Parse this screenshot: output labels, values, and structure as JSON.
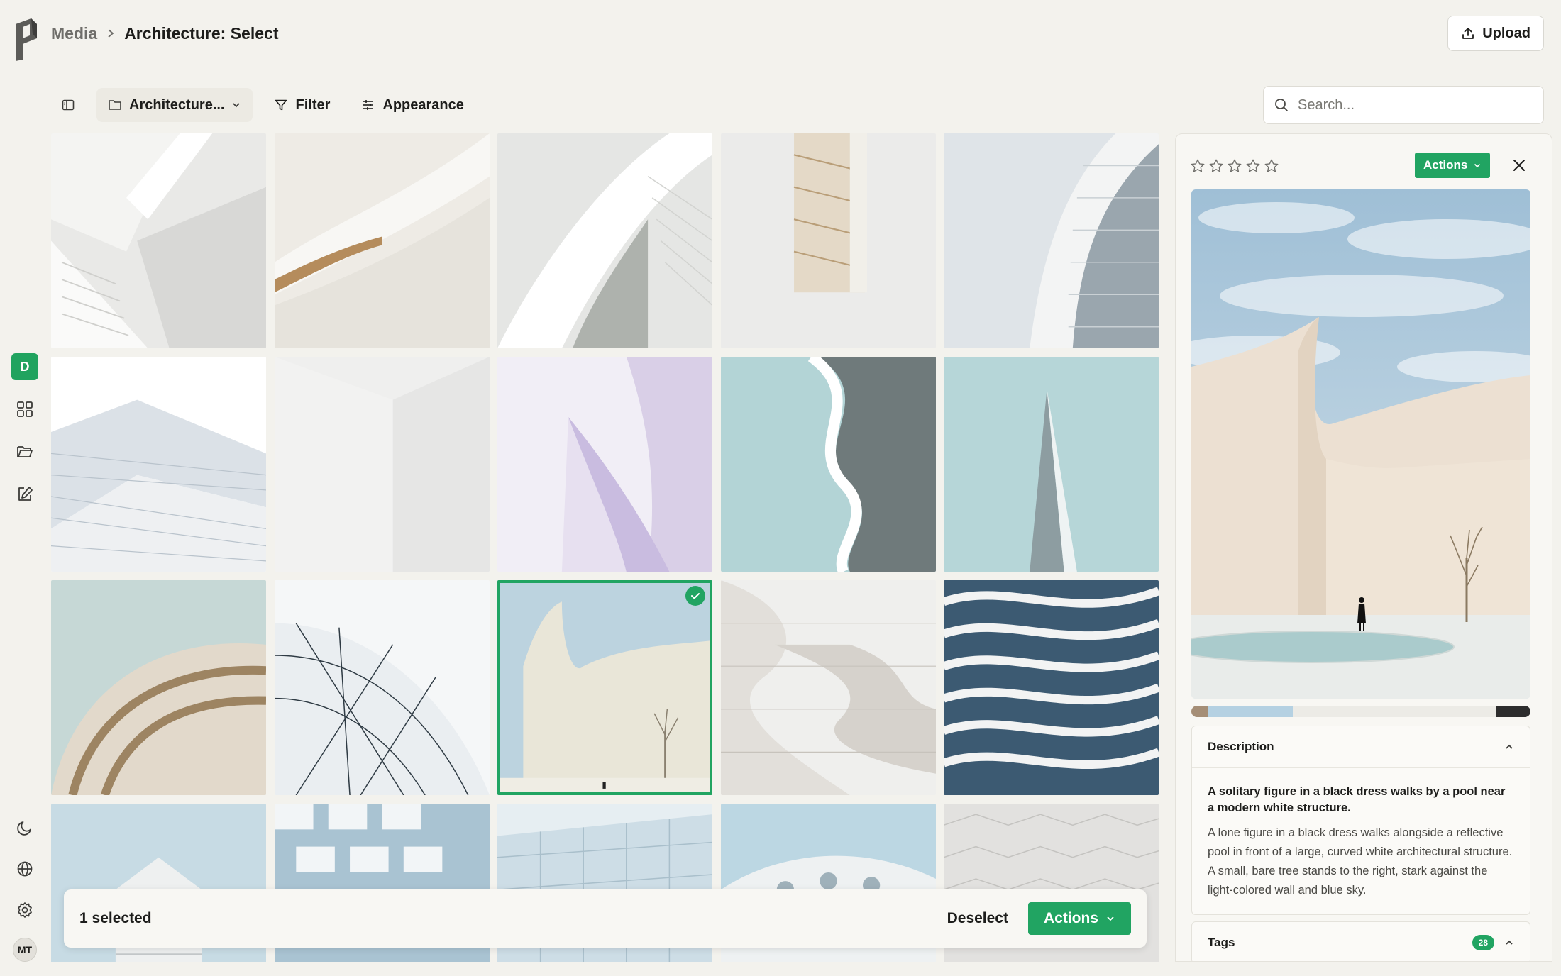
{
  "app": {
    "logo_name": "P"
  },
  "breadcrumb": {
    "root": "Media",
    "current": "Architecture: Select"
  },
  "header": {
    "upload_label": "Upload"
  },
  "toolbar": {
    "folder_label": "Architecture...",
    "filter_label": "Filter",
    "appearance_label": "Appearance"
  },
  "search": {
    "placeholder": "Search..."
  },
  "rail": {
    "workspace_initial": "D",
    "avatar_initials": "MT"
  },
  "selection_bar": {
    "count_text": "1 selected",
    "deselect_label": "Deselect",
    "actions_label": "Actions"
  },
  "panel": {
    "rating": 0,
    "rating_max": 5,
    "actions_label": "Actions",
    "palette": [
      "#a58e76",
      "#b5d1e2",
      "#ecebe6",
      "#2d2d2d"
    ],
    "palette_weights": [
      5,
      25,
      60,
      10
    ],
    "description": {
      "heading": "Description",
      "title": "A solitary figure in a black dress walks by a pool near a modern white structure.",
      "text": "A lone figure in a black dress walks alongside a reflective pool in front of a large, curved white architectural structure. A small, bare tree stands to the right, stark against the light-colored wall and blue sky."
    },
    "tags": {
      "heading": "Tags",
      "count": "28"
    }
  },
  "grid": {
    "selected_index": 12,
    "tile_count": 20
  },
  "colors": {
    "accent": "#21a462",
    "background": "#f3f2ed"
  }
}
